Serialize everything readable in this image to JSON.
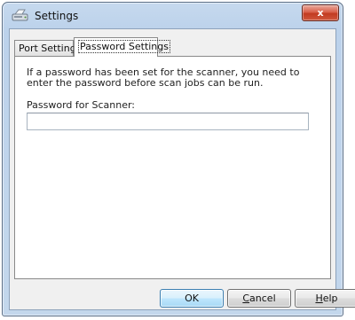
{
  "window": {
    "title": "Settings",
    "close_label": "x"
  },
  "tabs": [
    {
      "label": "Port Settings",
      "active": false
    },
    {
      "label": "Password Settings",
      "active": true
    }
  ],
  "panel": {
    "description": "If a password has been set for the scanner, you need to enter the password before scan jobs can be run.",
    "password_label": "Password for Scanner:",
    "password_value": ""
  },
  "buttons": {
    "ok": {
      "label": "OK"
    },
    "cancel": {
      "mnemonic": "C",
      "rest": "ancel"
    },
    "help": {
      "mnemonic": "H",
      "rest": "elp"
    }
  },
  "icons": {
    "app": "scanner-icon",
    "close": "close-icon"
  },
  "colors": {
    "titlebar": "#bcd2eb",
    "close_button": "#c23b21",
    "default_button_border": "#3c7fb1"
  }
}
